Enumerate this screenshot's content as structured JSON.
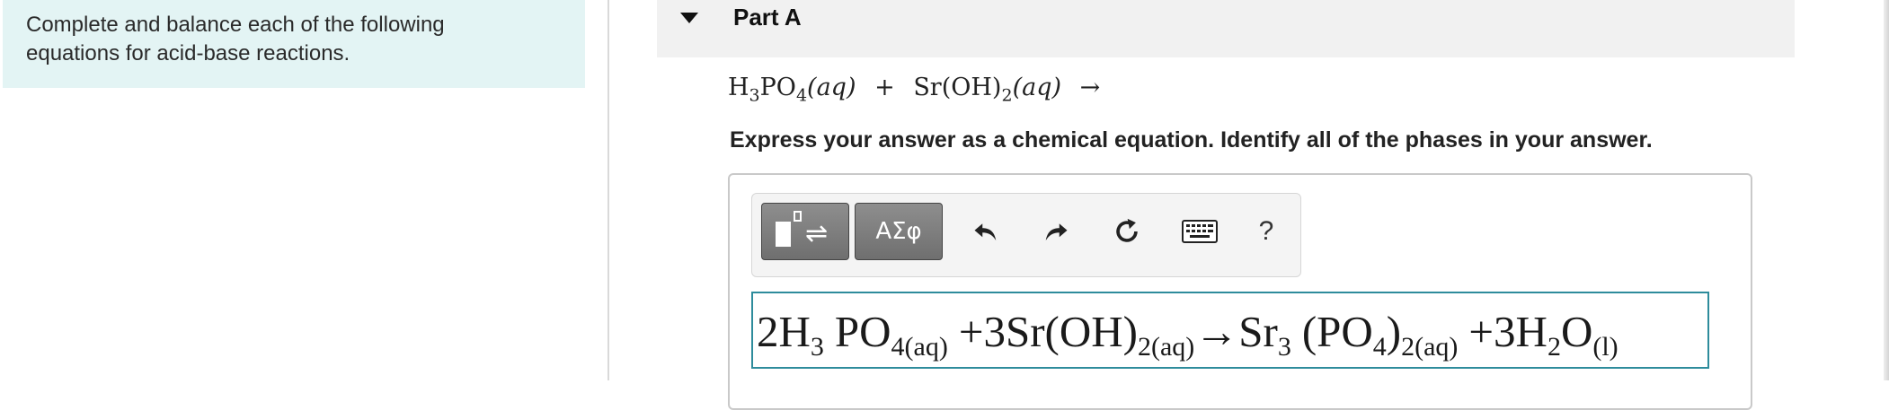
{
  "intro": {
    "line1": "Complete and balance each of the following",
    "line2": "equations for acid-base reactions."
  },
  "part": {
    "title": "Part A"
  },
  "question": {
    "reactant1_main": "H",
    "reactant1_sub1": "3",
    "reactant1_mid": "PO",
    "reactant1_sub2": "4",
    "reactant1_phase": "(aq)",
    "plus": "+",
    "reactant2_main": "Sr(OH)",
    "reactant2_sub": "2",
    "reactant2_phase": "(aq)",
    "arrow": "→"
  },
  "instruction": "Express your answer as a chemical equation. Identify all of the phases in your answer.",
  "toolbar": {
    "templates_icon": "templates-icon",
    "greek_label": "ΑΣφ",
    "undo_icon": "undo-icon",
    "redo_icon": "redo-icon",
    "reset_icon": "reset-icon",
    "keyboard_icon": "keyboard-icon",
    "help_label": "?"
  },
  "answer": {
    "t1": "2H",
    "s1": "3",
    "t2": "PO",
    "s2": "4(aq)",
    "t3": "+3Sr(OH)",
    "s3": "2(aq)",
    "t4": "→Sr",
    "s4": "3",
    "t5": "(PO",
    "s5": "4",
    "t6": ")",
    "s6": "2(aq)",
    "t7": "+3H",
    "s7": "2",
    "t8": "O",
    "s8": "(l)"
  },
  "colors": {
    "intro_bg": "#e3f4f4",
    "header_bg": "#f1f1f1",
    "input_border": "#2e8c9c",
    "button_bg": "#7f7f7f"
  }
}
